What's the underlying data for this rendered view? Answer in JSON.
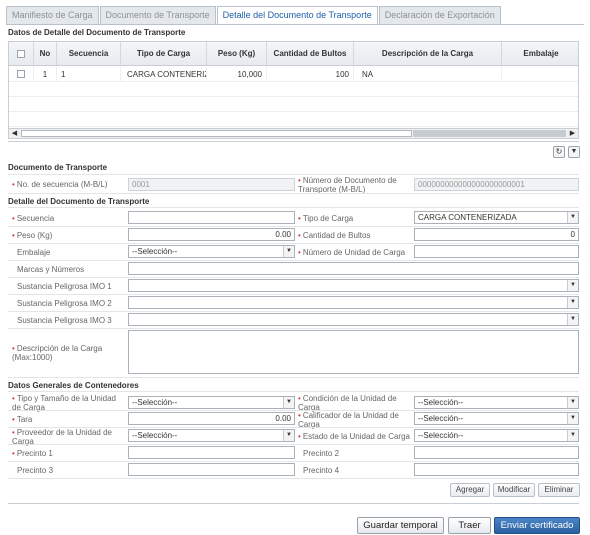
{
  "tabs": [
    "Manifiesto de Carga",
    "Documento de Transporte",
    "Detalle del Documento de Transporte",
    "Declaración de Exportación"
  ],
  "grid": {
    "title": "Datos de Detalle del Documento de Transporte",
    "columns": [
      "No",
      "Secuencia",
      "Tipo de Carga",
      "Peso (Kg)",
      "Cantidad de Bultos",
      "Descripción de la Carga",
      "Embalaje"
    ],
    "rows": [
      {
        "no": "1",
        "secuencia": "1",
        "tipo": "CARGA CONTENERIZADA",
        "peso": "10,000",
        "bultos": "100",
        "descripcion": "NA",
        "embalaje": ""
      }
    ]
  },
  "doc": {
    "title": "Documento de Transporte",
    "seq_label": "No. de secuencia (M-B/L)",
    "seq_value": "0001",
    "num_label": "Número de Documento de Transporte (M-B/L)",
    "num_value": "000000000000000000000001"
  },
  "detail": {
    "title": "Detalle del Documento de Transporte",
    "secuencia_label": "Secuencia",
    "secuencia_value": "",
    "tipo_label": "Tipo de Carga",
    "tipo_value": "CARGA CONTENERIZADA",
    "peso_label": "Peso (Kg)",
    "peso_value": "0.00",
    "bultos_label": "Cantidad de Bultos",
    "bultos_value": "0",
    "embalaje_label": "Embalaje",
    "embalaje_value": "--Selección--",
    "unidad_label": "Número de Unidad de Carga",
    "unidad_value": "",
    "marcas_label": "Marcas y Números",
    "imo1_label": "Sustancia Peligrosa IMO 1",
    "imo2_label": "Sustancia Peligrosa IMO 2",
    "imo3_label": "Sustancia Peligrosa IMO 3",
    "desc_label": "Descripción de la Carga (Max:1000)"
  },
  "cont": {
    "title": "Datos Generales de Contenedores",
    "tipo_label": "Tipo y Tamaño de la Unidad de Carga",
    "tipo_value": "--Selección--",
    "cond_label": "Condición de la Unidad de Carga",
    "cond_value": "--Selección--",
    "tara_label": "Tara",
    "tara_value": "0.00",
    "calif_label": "Calificador de la Unidad de Carga",
    "calif_value": "--Selección--",
    "prov_label": "Proveedor de la Unidad de Carga",
    "prov_value": "--Selección--",
    "estado_label": "Estado de la Unidad de Carga",
    "estado_value": "--Selección--",
    "p1_label": "Precinto 1",
    "p2_label": "Precinto 2",
    "p3_label": "Precinto 3",
    "p4_label": "Precinto 4"
  },
  "actions": {
    "agregar": "Agregar",
    "modificar": "Modificar",
    "eliminar": "Eliminar"
  },
  "footer": {
    "guardar": "Guardar temporal",
    "traer": "Traer",
    "enviar": "Enviar certificado"
  },
  "icons": {
    "refresh": "refresh-icon",
    "collapse": "chevron-down-icon",
    "dropdown": "chevron-down-icon"
  },
  "colors": {
    "accent": "#2a5f9e",
    "active_tab_text": "#1f5fa8",
    "required": "#d23b3b"
  }
}
